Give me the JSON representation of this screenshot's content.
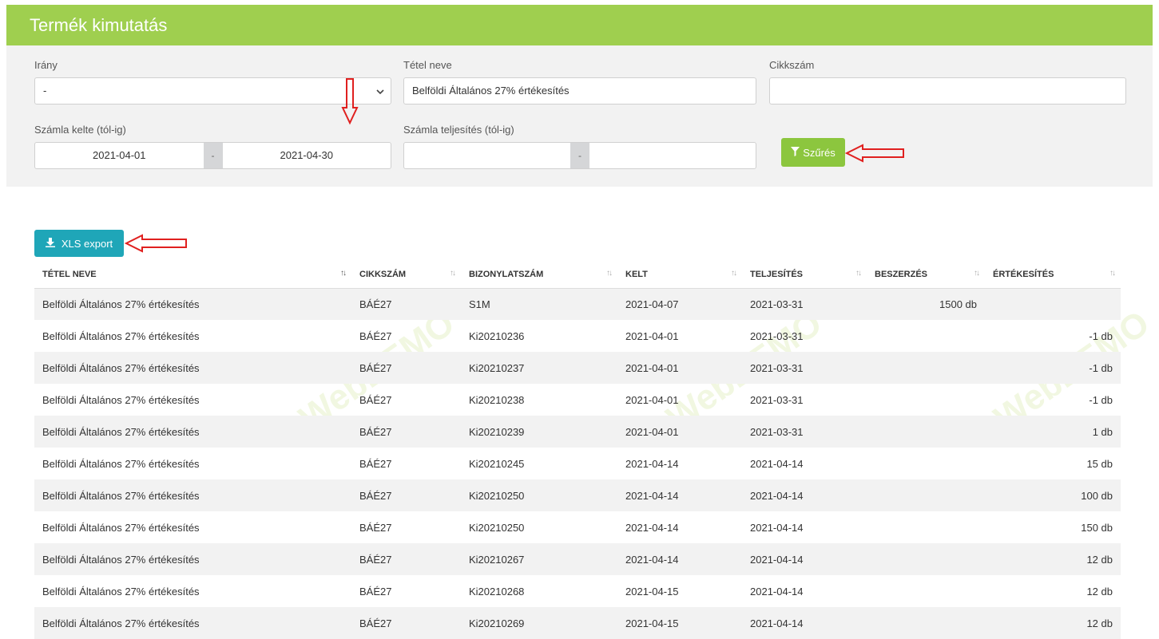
{
  "header": {
    "title": "Termék kimutatás"
  },
  "filters": {
    "direction": {
      "label": "Irány",
      "value": "-"
    },
    "item_name": {
      "label": "Tétel neve",
      "value": "Belföldi Általános 27% értékesítés"
    },
    "sku": {
      "label": "Cikkszám",
      "value": ""
    },
    "invoice_date": {
      "label": "Számla kelte (tól-ig)",
      "from": "2021-04-01",
      "separator": "-",
      "to": "2021-04-30"
    },
    "fulfillment_date": {
      "label": "Számla teljesítés (tól-ig)",
      "from": "",
      "separator": "-",
      "to": ""
    },
    "filter_button": "Szűrés"
  },
  "export": {
    "label": "XLS export"
  },
  "table": {
    "columns": [
      "TÉTEL NEVE",
      "CIKKSZÁM",
      "BIZONYLATSZÁM",
      "KELT",
      "TELJESÍTÉS",
      "BESZERZÉS",
      "ÉRTÉKESÍTÉS"
    ],
    "rows": [
      [
        "Belföldi Általános 27% értékesítés",
        "BÁÉ27",
        "S1M",
        "2021-04-07",
        "2021-03-31",
        "1500 db",
        ""
      ],
      [
        "Belföldi Általános 27% értékesítés",
        "BÁÉ27",
        "Ki20210236",
        "2021-04-01",
        "2021-03-31",
        "",
        "-1 db"
      ],
      [
        "Belföldi Általános 27% értékesítés",
        "BÁÉ27",
        "Ki20210237",
        "2021-04-01",
        "2021-03-31",
        "",
        "-1 db"
      ],
      [
        "Belföldi Általános 27% értékesítés",
        "BÁÉ27",
        "Ki20210238",
        "2021-04-01",
        "2021-03-31",
        "",
        "-1 db"
      ],
      [
        "Belföldi Általános 27% értékesítés",
        "BÁÉ27",
        "Ki20210239",
        "2021-04-01",
        "2021-03-31",
        "",
        "1 db"
      ],
      [
        "Belföldi Általános 27% értékesítés",
        "BÁÉ27",
        "Ki20210245",
        "2021-04-14",
        "2021-04-14",
        "",
        "15 db"
      ],
      [
        "Belföldi Általános 27% értékesítés",
        "BÁÉ27",
        "Ki20210250",
        "2021-04-14",
        "2021-04-14",
        "",
        "100 db"
      ],
      [
        "Belföldi Általános 27% értékesítés",
        "BÁÉ27",
        "Ki20210250",
        "2021-04-14",
        "2021-04-14",
        "",
        "150 db"
      ],
      [
        "Belföldi Általános 27% értékesítés",
        "BÁÉ27",
        "Ki20210267",
        "2021-04-14",
        "2021-04-14",
        "",
        "12 db"
      ],
      [
        "Belföldi Általános 27% értékesítés",
        "BÁÉ27",
        "Ki20210268",
        "2021-04-15",
        "2021-04-14",
        "",
        "12 db"
      ],
      [
        "Belföldi Általános 27% értékesítés",
        "BÁÉ27",
        "Ki20210269",
        "2021-04-15",
        "2021-04-14",
        "",
        "12 db"
      ]
    ]
  },
  "icons": {
    "chevron": "chevron-down-icon",
    "filter": "filter-icon",
    "download": "download-icon"
  },
  "colors": {
    "header": "#9fcf4f",
    "filter_button": "#8cc63e",
    "export_button": "#1fa6b8",
    "annotation_arrow": "#e0201f"
  }
}
